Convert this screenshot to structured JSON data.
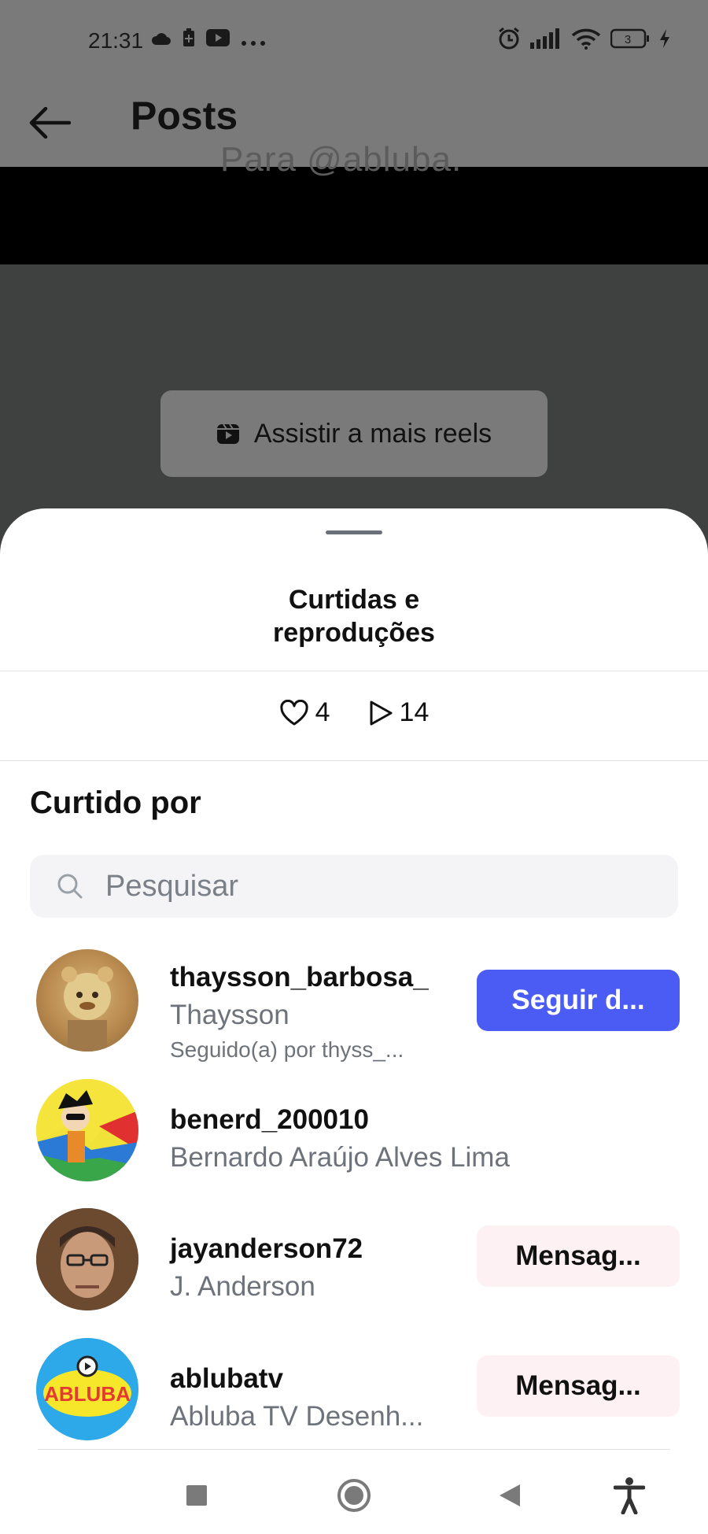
{
  "status_bar": {
    "time": "21:31",
    "left_icons": [
      "cloud-icon",
      "battery-saver-icon",
      "youtube-icon",
      "more-dots-icon"
    ],
    "right_icons": [
      "alarm-icon",
      "signal-icon",
      "wifi-icon",
      "battery-icon",
      "charging-icon"
    ],
    "battery_level": "3"
  },
  "header": {
    "title": "Posts",
    "back_icon": "arrow-left-icon"
  },
  "background": {
    "ghost_text": "Para @abluba.",
    "reels_button_label": "Assistir a mais reels"
  },
  "sheet": {
    "title_line1": "Curtidas e",
    "title_line2": "reproduções",
    "likes_count": "4",
    "plays_count": "14",
    "section_title": "Curtido por",
    "search_placeholder": "Pesquisar",
    "users": [
      {
        "username": "thaysson_barbosa_",
        "full_name": "Thaysson",
        "followed_by": "Seguido(a) por thyss_...",
        "action": "Seguir d..."
      },
      {
        "username": "benerd_200010",
        "full_name": "Bernardo Araújo Alves Lima",
        "action": ""
      },
      {
        "username": "jayanderson72",
        "full_name": "J. Anderson",
        "action": "Mensag..."
      },
      {
        "username": "ablubatv",
        "full_name": "Abluba TV Desenh...",
        "action": "Mensag...",
        "logo_text": "ABLUBA"
      }
    ]
  },
  "colors": {
    "follow_button": "#4a5cf4",
    "message_button": "#fdf1f4",
    "overlay": "#3f4040"
  }
}
